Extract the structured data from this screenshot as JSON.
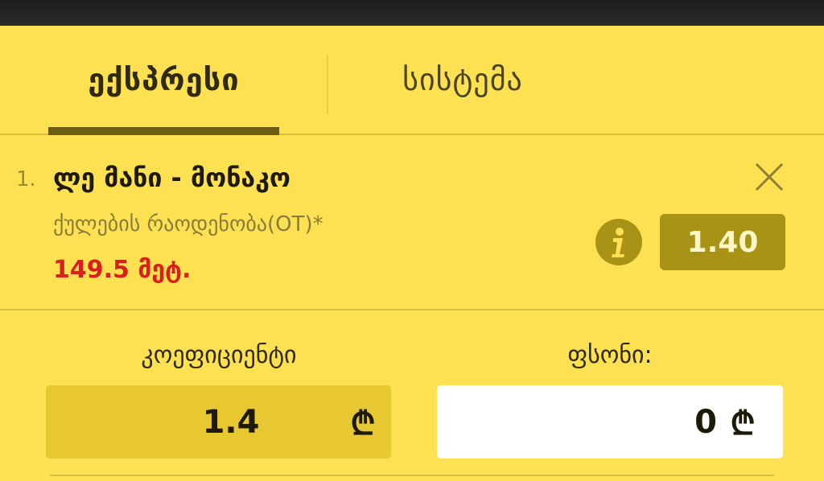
{
  "tabs": {
    "express": "ექსპრესი",
    "system": "სისტემა"
  },
  "bet": {
    "index": "1.",
    "title": "ლე მანი - მონაკო",
    "market": "ქულების რაოდენობა(OT)*",
    "selection": "149.5 მეტ.",
    "odds": "1.40"
  },
  "fields": {
    "coefficient_label": "კოეფიციენტი",
    "coefficient_value": "1.4",
    "stake_label": "ფსონი:",
    "stake_value": "0",
    "currency_symbol": "₾"
  },
  "icons": {
    "close": "close-icon",
    "info": "info-icon"
  },
  "colors": {
    "background": "#fde152",
    "accent": "#a89317",
    "selection_red": "#d8201c"
  }
}
